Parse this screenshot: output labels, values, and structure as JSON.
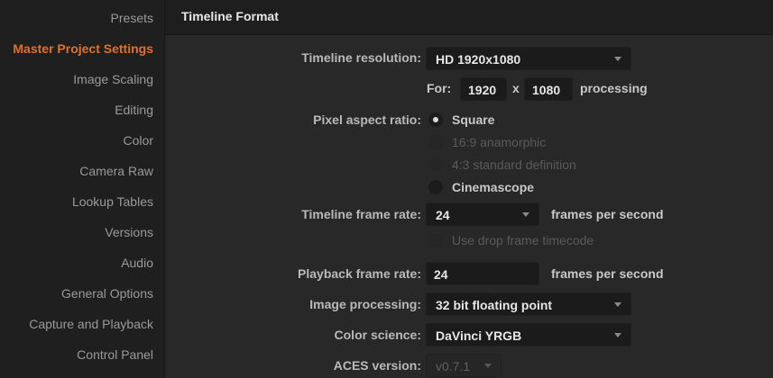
{
  "sidebar": {
    "items": [
      {
        "label": "Presets"
      },
      {
        "label": "Master Project Settings",
        "active": true
      },
      {
        "label": "Image Scaling"
      },
      {
        "label": "Editing"
      },
      {
        "label": "Color"
      },
      {
        "label": "Camera Raw"
      },
      {
        "label": "Lookup Tables"
      },
      {
        "label": "Versions"
      },
      {
        "label": "Audio"
      },
      {
        "label": "General Options"
      },
      {
        "label": "Capture and Playback"
      },
      {
        "label": "Control Panel"
      }
    ]
  },
  "header": {
    "title": "Timeline Format"
  },
  "form": {
    "timeline_resolution": {
      "label": "Timeline resolution:",
      "value": "HD 1920x1080"
    },
    "processing": {
      "for_label": "For:",
      "width": "1920",
      "x_label": "x",
      "height": "1080",
      "suffix": "processing"
    },
    "pixel_aspect": {
      "label": "Pixel aspect ratio:",
      "options": [
        {
          "label": "Square",
          "selected": true,
          "enabled": true
        },
        {
          "label": "16:9 anamorphic",
          "selected": false,
          "enabled": false
        },
        {
          "label": "4:3 standard definition",
          "selected": false,
          "enabled": false
        },
        {
          "label": "Cinemascope",
          "selected": false,
          "enabled": true
        }
      ]
    },
    "timeline_frame_rate": {
      "label": "Timeline frame rate:",
      "value": "24",
      "suffix": "frames per second"
    },
    "drop_frame": {
      "label": "Use drop frame timecode",
      "checked": false,
      "enabled": false
    },
    "playback_frame_rate": {
      "label": "Playback frame rate:",
      "value": "24",
      "suffix": "frames per second"
    },
    "image_processing": {
      "label": "Image processing:",
      "value": "32 bit floating point"
    },
    "color_science": {
      "label": "Color science:",
      "value": "DaVinci YRGB"
    },
    "aces_version": {
      "label": "ACES version:",
      "value": "v0.7.1",
      "enabled": false
    }
  },
  "colors": {
    "accent": "#e0702a",
    "background": "#282828",
    "sidebar": "#1f1f1f",
    "field": "#1b1b1b"
  }
}
